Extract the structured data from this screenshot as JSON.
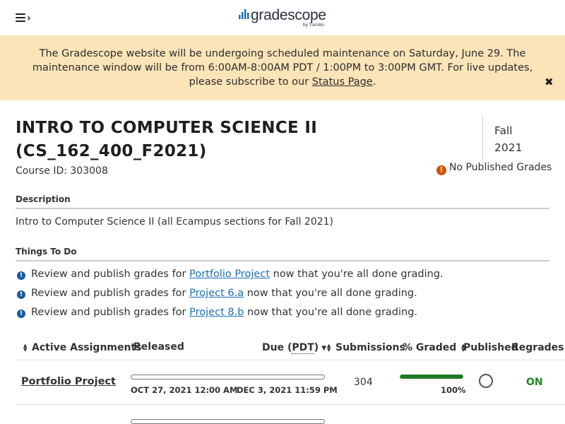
{
  "header": {
    "logo_text": "gradescope",
    "logo_subtext": "by Turnitin",
    "menu_icon": "hamburger-menu-icon"
  },
  "banner": {
    "message_part1": "The Gradescope website will be undergoing scheduled maintenance on Saturday, June 29. The maintenance window will be from 6:00AM-8:00AM PDT / 1:00PM to 3:00PM GMT. For live updates, please subscribe to our ",
    "link_text": "Status Page",
    "message_part2": ".",
    "close_symbol": "✖",
    "background_color": "#fae4b8"
  },
  "course": {
    "title": "INTRO TO COMPUTER SCIENCE II (CS_162_400_F2021)",
    "course_id": "Course ID: 303008",
    "term_line1": "Fall",
    "term_line2": "2021",
    "grades_status": "No Published Grades"
  },
  "description": {
    "heading": "Description",
    "text": "Intro to Computer Science II (all Ecampus sections for Fall 2021)"
  },
  "todo": {
    "heading": "Things To Do",
    "items": [
      {
        "prefix": "Review and publish grades for ",
        "link": "Portfolio Project",
        "suffix": " now that you're all done grading."
      },
      {
        "prefix": "Review and publish grades for ",
        "link": "Project 6.a",
        "suffix": " now that you're all done grading."
      },
      {
        "prefix": "Review and publish grades for ",
        "link": "Project 8.b",
        "suffix": " now that you're all done grading."
      }
    ]
  },
  "table": {
    "columns": {
      "name": "Active Assignments",
      "released": "Released",
      "due_prefix": "Due (",
      "due_tz": "PDT",
      "due_suffix": ")",
      "submissions": "Submissions",
      "graded": "% Graded",
      "published": "Published",
      "regrades": "Regrades"
    },
    "rows": [
      {
        "name": "Portfolio Project",
        "released": "OCT 27, 2021 12:00 AM",
        "due": "DEC 3, 2021 11:59 PM",
        "submissions": "304",
        "graded_pct": "100%",
        "graded_fraction": 1.0,
        "published": false,
        "regrades": "ON"
      }
    ]
  },
  "colors": {
    "link": "#1a6fb8",
    "progress_fill": "#1e7b1e",
    "regrades_on": "#1e8a1e",
    "warning": "#d35400",
    "info": "#1b5a9e"
  }
}
